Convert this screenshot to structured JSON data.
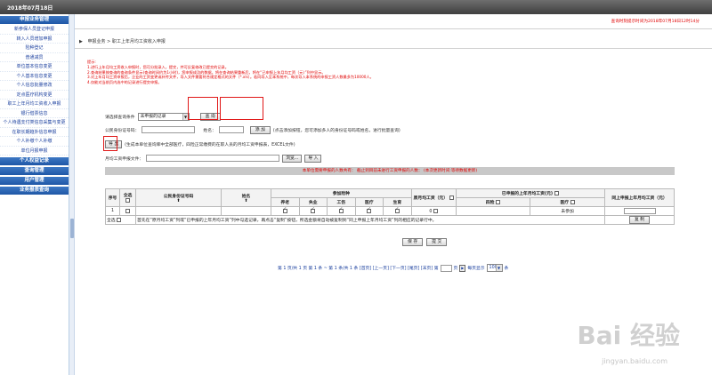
{
  "topbar": {
    "date": "2018年07月18日"
  },
  "sidebar": {
    "sections": [
      {
        "title": "申报业务管理",
        "items": [
          "新参保人员登记申报",
          "转入人员增加申报",
          "险种登记",
          "普通减员",
          "单位基本信息变更",
          "个人基本信息变更",
          "个人信息批量修改",
          "定点医疗机构变更",
          "职工上年月均工资收入申报",
          "银行借票信息",
          "个人待遇支付类信息采集与变更",
          "在职长期趋外信息申报",
          "个人补缴个人补缴",
          "单位月报申报"
        ]
      },
      {
        "title": "个人权益记录",
        "items": []
      },
      {
        "title": "查询管理",
        "items": []
      },
      {
        "title": "用户管理",
        "items": []
      },
      {
        "title": "业务报表查询",
        "items": []
      }
    ]
  },
  "header": {
    "status": "查询时刻提示时间为2018年07月18日12时14分",
    "breadcrumb_root": "申报业务",
    "breadcrumb_sep": ">",
    "breadcrumb_current": "职工上年月均工资收入申报"
  },
  "tips": {
    "title": "提示:",
    "lines": [
      "1.进行上年月均工资收入申报时，您可分批录入，提交，并可反复修改已提交的记录。",
      "2.查询结果按查询的查询条件显示(查询时间约为1小时)，您申报成功的数据，将在查询结果重新后，将在“已申报上年月均工资（元）”列中显示。",
      "3.对上年月均工资申报后，企业的工资变更或补传文件，导入文件需要符合规定格式的文件（*.xls）。若同导入至本系统中，每次导入本系统的申报工资人数最多为10000人。",
      "4.仅能对当前页内选中的记录进行提交申报。"
    ]
  },
  "form": {
    "query_label": "请选择查询条件",
    "query_value": "未申报的记录",
    "query_button": "查 询",
    "id_label": "公民身份证号码：",
    "name_label": "姓名：",
    "add_button": "添 加",
    "add_hint": "(点击添加按钮，您可添加多人的身份证号码或姓名，进行批量查询)",
    "export_button": "导 出",
    "export_hint": "(生成本单位查询库中全部医疗，四险正常缴费的在职人员的月均工资申报表，EXCEL文件)",
    "import_label": "月均工资申报文件：",
    "browse_button": "浏览...",
    "import_button": "导 入",
    "warning": "本单位需要申报的人数共有：   截止到目前未进行工资申报的人数：   (本次更新时间:等待数据更新)"
  },
  "table": {
    "headers": {
      "seq": "序号",
      "select_all": "全选",
      "id": "公民身份证号码",
      "name": "姓名",
      "insure": "参加险种",
      "avg_wage": "原月均工资（元）",
      "declared": "已申报的上年月均工资(元)",
      "last_year": "同上申报上年月均工资（元）"
    },
    "insure_types": [
      "养老",
      "失业",
      "工伤",
      "医疗",
      "生育"
    ],
    "declared_sub": [
      "四险",
      "医疗"
    ],
    "rows": [
      {
        "seq": "1",
        "avg_wage": "0",
        "status": "未参加"
      }
    ],
    "select_all_label": "全选",
    "footer_note": "首先在“原月均工资”列或“已申报的上年月均工资”列中勾选记录，再点击“复制”按钮，所选金额将自动被复制到“同上申报上年月均工资”列的相应的记录行中。",
    "copy_button": "复 制"
  },
  "actions": {
    "save": "保 存",
    "submit": "提 交"
  },
  "pager": {
    "text": "第 1 页/共 1 页 第 1 条 ~ 第 1 条/共 1 条 [首页] [上一页] [下一页] [尾页] [末页] 第",
    "page_suffix": "页",
    "per_page_label": "每页显示",
    "per_page_value": "100",
    "per_page_suffix": "条"
  },
  "watermark": {
    "brand": "Bai 经验",
    "url": "jingyan.baidu.com"
  }
}
